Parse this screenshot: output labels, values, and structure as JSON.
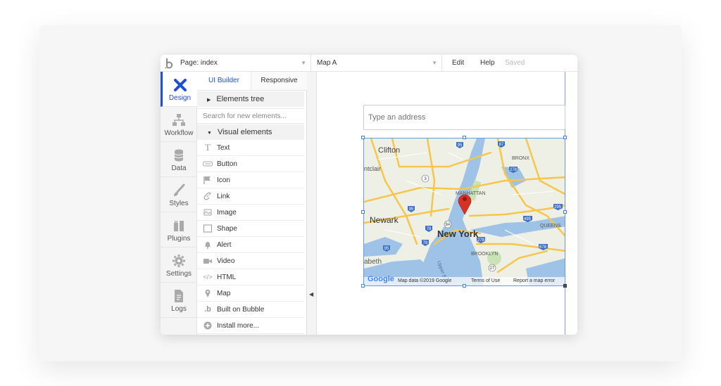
{
  "topbar": {
    "page_selector": "Page: index",
    "element_selector": "Map A",
    "edit": "Edit",
    "help": "Help",
    "status": "Saved"
  },
  "leftnav": {
    "items": [
      {
        "label": "Design",
        "icon": "design-icon",
        "active": true
      },
      {
        "label": "Workflow",
        "icon": "workflow-icon"
      },
      {
        "label": "Data",
        "icon": "database-icon"
      },
      {
        "label": "Styles",
        "icon": "brush-icon"
      },
      {
        "label": "Plugins",
        "icon": "plugin-icon"
      },
      {
        "label": "Settings",
        "icon": "gear-icon"
      },
      {
        "label": "Logs",
        "icon": "document-icon"
      }
    ]
  },
  "panel": {
    "tabs": [
      "UI Builder",
      "Responsive"
    ],
    "elements_tree": "Elements tree",
    "search_placeholder": "Search for new elements...",
    "visual_elements": "Visual elements",
    "elements": [
      {
        "label": "Text",
        "icon": "text-icon"
      },
      {
        "label": "Button",
        "icon": "button-icon"
      },
      {
        "label": "Icon",
        "icon": "flag-icon"
      },
      {
        "label": "Link",
        "icon": "link-icon"
      },
      {
        "label": "Image",
        "icon": "image-icon"
      },
      {
        "label": "Shape",
        "icon": "shape-icon"
      },
      {
        "label": "Alert",
        "icon": "bell-icon"
      },
      {
        "label": "Video",
        "icon": "video-icon"
      },
      {
        "label": "HTML",
        "icon": "code-icon"
      },
      {
        "label": "Map",
        "icon": "map-pin-icon"
      },
      {
        "label": "Built on Bubble",
        "icon": "bubble-logo-icon"
      },
      {
        "label": "Install more...",
        "icon": "plus-circle-icon"
      }
    ]
  },
  "canvas": {
    "address_placeholder": "Type an address",
    "map": {
      "labels": {
        "clifton": "Clifton",
        "bronx": "BRONX",
        "manhattan": "MANHATTAN",
        "newark": "Newark",
        "new_york": "New York",
        "queens": "QUEENS",
        "brooklyn": "BROOKLYN",
        "montclair": "ntclair",
        "elizabeth": "abeth",
        "upper_bay": "Upper Bay"
      },
      "shields": [
        "95",
        "87",
        "278",
        "3",
        "95",
        "295",
        "495",
        "78",
        "9A",
        "78",
        "95",
        "278",
        "678",
        "27"
      ],
      "google": "Google",
      "attribution": "Map data ©2019 Google",
      "terms": "Terms of Use",
      "report": "Report a map error"
    }
  },
  "colors": {
    "accent": "#1d4ed8",
    "pin": "#d93025",
    "water": "#9ec3e6",
    "land": "#eef0e6",
    "road": "#f6c64a"
  }
}
